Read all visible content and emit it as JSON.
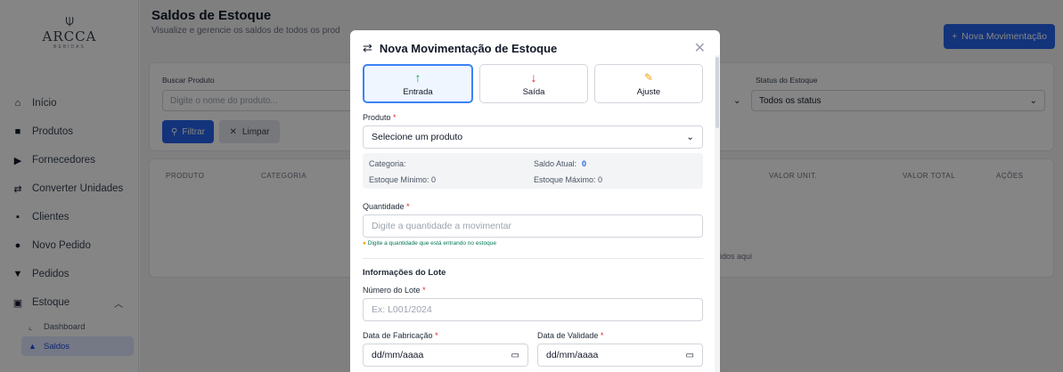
{
  "logo": {
    "mark": "⍦",
    "name": "ARCCA",
    "tagline": "BEBIDAS"
  },
  "sidebar": {
    "items": [
      {
        "label": "Início",
        "icon": "home-icon"
      },
      {
        "label": "Produtos",
        "icon": "box-icon"
      },
      {
        "label": "Fornecedores",
        "icon": "truck-icon"
      },
      {
        "label": "Converter Unidades",
        "icon": "swap-icon"
      },
      {
        "label": "Clientes",
        "icon": "users-icon"
      },
      {
        "label": "Novo Pedido",
        "icon": "circle-icon"
      },
      {
        "label": "Pedidos",
        "icon": "cart-icon"
      },
      {
        "label": "Estoque",
        "icon": "warehouse-icon"
      }
    ],
    "sub_items": [
      {
        "label": "Dashboard",
        "icon": "chart-icon"
      },
      {
        "label": "Saldos",
        "icon": "boxes-icon"
      }
    ]
  },
  "header": {
    "title": "Saldos de Estoque",
    "subtitle": "Visualize e gerencie os saldos de todos os prod",
    "new_button": "Nova Movimentação"
  },
  "filters": {
    "search_label": "Buscar Produto",
    "search_placeholder": "Digite o nome do produto...",
    "status_label": "Status do Estoque",
    "status_value": "Todos os status",
    "filter_button": "Filtrar",
    "clear_button": "Limpar"
  },
  "table": {
    "headers": [
      "PRODUTO",
      "CATEGORIA",
      "VALOR UNIT.",
      "VALOR TOTAL",
      "AÇÕES"
    ],
    "empty_text": "idos aqui"
  },
  "modal": {
    "title": "Nova Movimentação de Estoque",
    "types": [
      {
        "label": "Entrada",
        "icon": "↑",
        "color": "#16a34a"
      },
      {
        "label": "Saída",
        "icon": "↓",
        "color": "#dc2626"
      },
      {
        "label": "Ajuste",
        "icon": "🔧",
        "color": "#f59e0b"
      }
    ],
    "product_label": "Produto",
    "product_value": "Selecione um produto",
    "info": {
      "categoria_label": "Categoria:",
      "saldo_label": "Saldo Atual:",
      "saldo_value": "0",
      "minimo_label": "Estoque Mínimo: 0",
      "maximo_label": "Estoque Máximo: 0"
    },
    "quantity_label": "Quantidade",
    "quantity_placeholder": "Digite a quantidade a movimentar",
    "quantity_hint": "Digite a quantidade que está entrando no estoque",
    "lot_section": "Informações do Lote",
    "lot_number_label": "Número do Lote",
    "lot_number_placeholder": "Ex: L001/2024",
    "fab_label": "Data de Fabricação",
    "fab_value": "dd/mm/aaaa",
    "val_label": "Data de Validade",
    "val_value": "dd/mm/aaaa",
    "required_mark": "*"
  },
  "colors": {
    "accent": "#2563eb",
    "overlay": "rgba(0,0,0,0.48)"
  }
}
